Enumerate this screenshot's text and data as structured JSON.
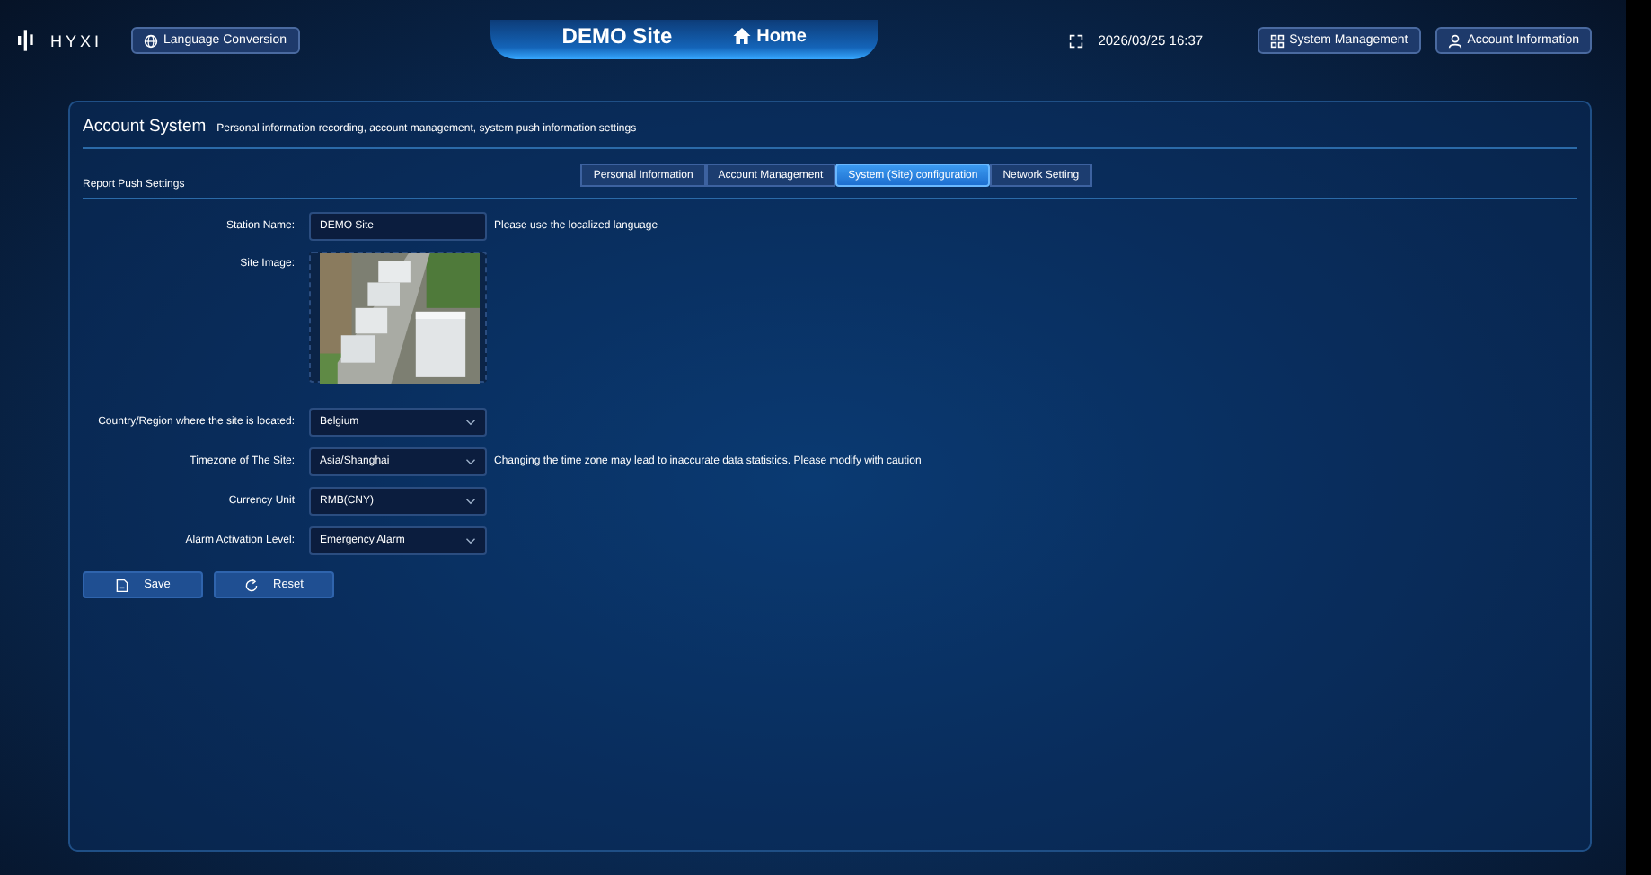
{
  "header": {
    "logo": "HYXI",
    "language_button": "Language Conversion",
    "site_title": "DEMO Site",
    "home_link": "Home",
    "datetime": "2026/03/25 16:37",
    "buttons": [
      "System Management",
      "Account Information"
    ]
  },
  "panel": {
    "title": "Account System",
    "subtitle": "Personal information recording, account management, system push information settings",
    "section": "Report Push Settings",
    "tabs": [
      {
        "label": "Personal Information",
        "selected": false
      },
      {
        "label": "Account Management",
        "selected": false
      },
      {
        "label": "System (Site) configuration",
        "selected": true
      },
      {
        "label": "Network Setting",
        "selected": false
      }
    ]
  },
  "form": [
    {
      "kind": "text",
      "label": "Station Name:",
      "value": "DEMO Site",
      "hint": "Please use the localized language"
    },
    {
      "label": "Site Image:"
    },
    {
      "kind": "select",
      "label": "Country/Region where the site is located:",
      "value": "Belgium"
    },
    {
      "kind": "select",
      "label": "Timezone of The Site:",
      "value": "Asia/Shanghai",
      "hint": "Changing the time zone may lead to inaccurate data statistics. Please modify with caution"
    },
    {
      "kind": "select",
      "label": "Currency Unit",
      "value": "RMB(CNY)"
    },
    {
      "kind": "select",
      "label": "Alarm Activation Level:",
      "value": "Emergency Alarm"
    }
  ],
  "actions": [
    {
      "kind": "save",
      "label": "Save"
    },
    {
      "kind": "reset",
      "label": "Reset"
    }
  ]
}
